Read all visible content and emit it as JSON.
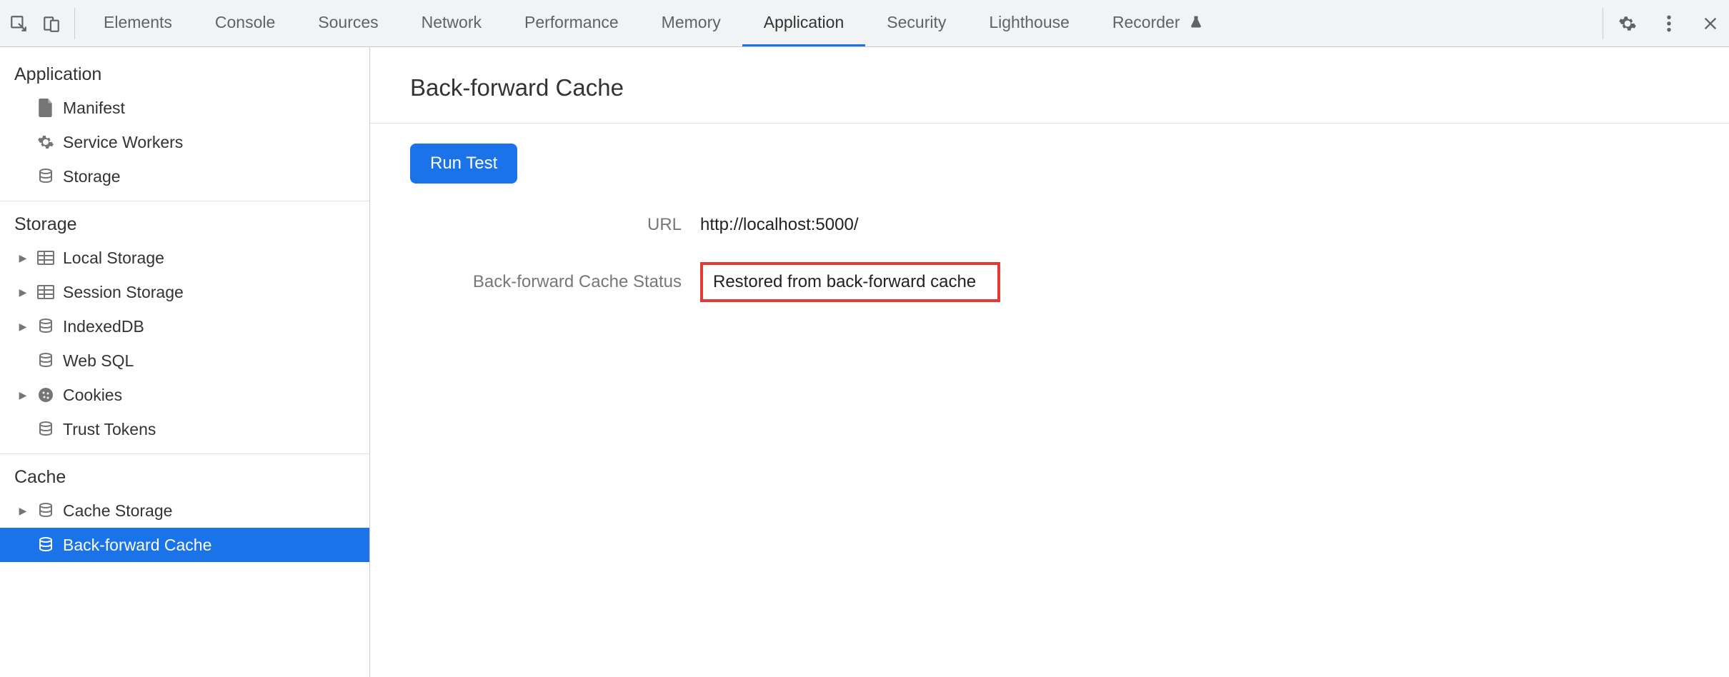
{
  "tabs": {
    "elements": "Elements",
    "console": "Console",
    "sources": "Sources",
    "network": "Network",
    "performance": "Performance",
    "memory": "Memory",
    "application": "Application",
    "security": "Security",
    "lighthouse": "Lighthouse",
    "recorder": "Recorder"
  },
  "sidebar": {
    "application": {
      "title": "Application",
      "manifest": "Manifest",
      "service_workers": "Service Workers",
      "storage": "Storage"
    },
    "storage": {
      "title": "Storage",
      "local_storage": "Local Storage",
      "session_storage": "Session Storage",
      "indexeddb": "IndexedDB",
      "web_sql": "Web SQL",
      "cookies": "Cookies",
      "trust_tokens": "Trust Tokens"
    },
    "cache": {
      "title": "Cache",
      "cache_storage": "Cache Storage",
      "back_forward_cache": "Back-forward Cache"
    }
  },
  "main": {
    "title": "Back-forward Cache",
    "run_test": "Run Test",
    "url_label": "URL",
    "url_value": "http://localhost:5000/",
    "status_label": "Back-forward Cache Status",
    "status_value": "Restored from back-forward cache"
  }
}
